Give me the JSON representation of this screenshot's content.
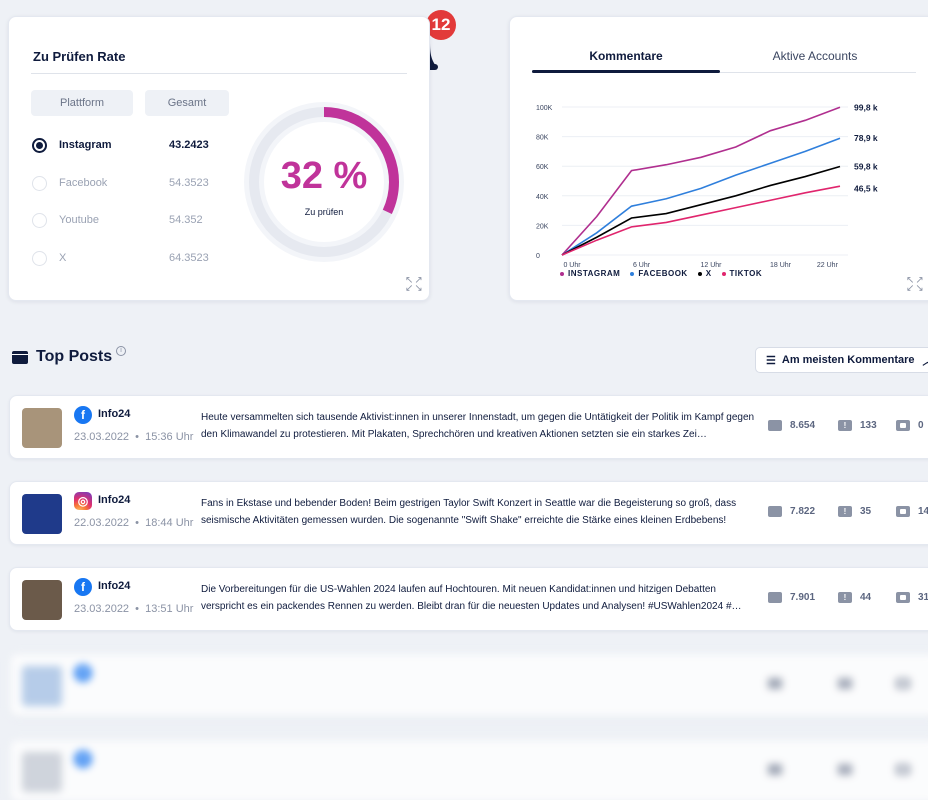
{
  "notification": {
    "count": "12"
  },
  "rate_card": {
    "title": "Zu Prüfen Rate",
    "col_platform": "Plattform",
    "col_total": "Gesamt",
    "platforms": [
      {
        "name": "Instagram",
        "value": "43.2423",
        "selected": true
      },
      {
        "name": "Facebook",
        "value": "54.3523",
        "selected": false
      },
      {
        "name": "Youtube",
        "value": "54.352",
        "selected": false
      },
      {
        "name": "X",
        "value": "64.3523",
        "selected": false
      }
    ],
    "percent_label": "32 %",
    "percent_value": 32,
    "percent_sub": "Zu prüfen",
    "accent": "#c0339a"
  },
  "chart_card": {
    "tabs": [
      "Kommentare",
      "Aktive Accounts"
    ],
    "active_tab": 0
  },
  "chart_data": {
    "type": "line",
    "x": [
      "0 Uhr",
      "3 Uhr",
      "6 Uhr",
      "9 Uhr",
      "12 Uhr",
      "15 Uhr",
      "18 Uhr",
      "21 Uhr",
      "24 Uhr"
    ],
    "x_tick_labels": [
      "0 Uhr",
      "6 Uhr",
      "12 Uhr",
      "18 Uhr",
      "22 Uhr"
    ],
    "y_tick_labels": [
      "0",
      "20K",
      "40K",
      "60K",
      "80K",
      "100K"
    ],
    "ylim": [
      0,
      100000
    ],
    "grid": true,
    "legend_position": "bottom-left",
    "series": [
      {
        "name": "INSTAGRAM",
        "color": "#b02f8f",
        "end_label": "99,8 k",
        "values": [
          0,
          26000,
          57000,
          61000,
          66000,
          73000,
          84000,
          91000,
          99800
        ]
      },
      {
        "name": "FACEBOOK",
        "color": "#2f7fdc",
        "end_label": "78,9 k",
        "values": [
          0,
          15000,
          33000,
          38000,
          45000,
          54000,
          62000,
          70000,
          78900
        ]
      },
      {
        "name": "X",
        "color": "#000000",
        "end_label": "59,8 k",
        "values": [
          0,
          12000,
          25000,
          28000,
          34000,
          40000,
          47000,
          53000,
          59800
        ]
      },
      {
        "name": "TIKTOK",
        "color": "#e0256d",
        "end_label": "46,5 k",
        "values": [
          0,
          10000,
          19000,
          22000,
          27000,
          32000,
          37000,
          42000,
          46500
        ]
      }
    ]
  },
  "top_posts": {
    "title": "Top Posts",
    "info_icon": "i",
    "sort_label": "Am meisten Kommentare",
    "posts": [
      {
        "network": "facebook",
        "account": "Info24",
        "date": "23.03.2022",
        "time": "15:36 Uhr",
        "text": "Heute versammelten sich tausende Aktivist:innen in unserer Innenstadt, um gegen die Untätigkeit der Politik im Kampf gegen den Klimawandel zu protestieren. Mit Plakaten, Sprechchören und kreativen Aktionen setzten sie ein starkes Zei…",
        "comments": "8.654",
        "flags": "133",
        "shares": "0",
        "thumb_color": "#a8947a"
      },
      {
        "network": "instagram",
        "account": "Info24",
        "date": "22.03.2022",
        "time": "18:44 Uhr",
        "text": "Fans in Ekstase und bebender Boden! Beim gestrigen Taylor Swift Konzert in Seattle war die Begeisterung so groß, dass seismische Aktivitäten gemessen wurden. Die sogenannte \"Swift Shake\" erreichte die Stärke eines kleinen Erdbebens!",
        "comments": "7.822",
        "flags": "35",
        "shares": "14",
        "thumb_color": "#1f3a8a"
      },
      {
        "network": "facebook",
        "account": "Info24",
        "date": "23.03.2022",
        "time": "13:51 Uhr",
        "text": "Die Vorbereitungen für die US-Wahlen 2024 laufen auf Hochtouren. Mit neuen Kandidat:innen und hitzigen Debatten verspricht es ein packendes Rennen zu werden. Bleibt dran für die neuesten Updates und Analysen! #USWahlen2024 #…",
        "comments": "7.901",
        "flags": "44",
        "shares": "31",
        "thumb_color": "#6b5a4a"
      },
      {
        "network": "facebook",
        "account": "",
        "date": "",
        "time": "",
        "text": "",
        "comments": "",
        "flags": "",
        "shares": "",
        "thumb_color": "#a9c4e6"
      },
      {
        "network": "facebook",
        "account": "",
        "date": "",
        "time": "",
        "text": "",
        "comments": "",
        "flags": "",
        "shares": "",
        "thumb_color": "#c8cdd6"
      }
    ]
  }
}
